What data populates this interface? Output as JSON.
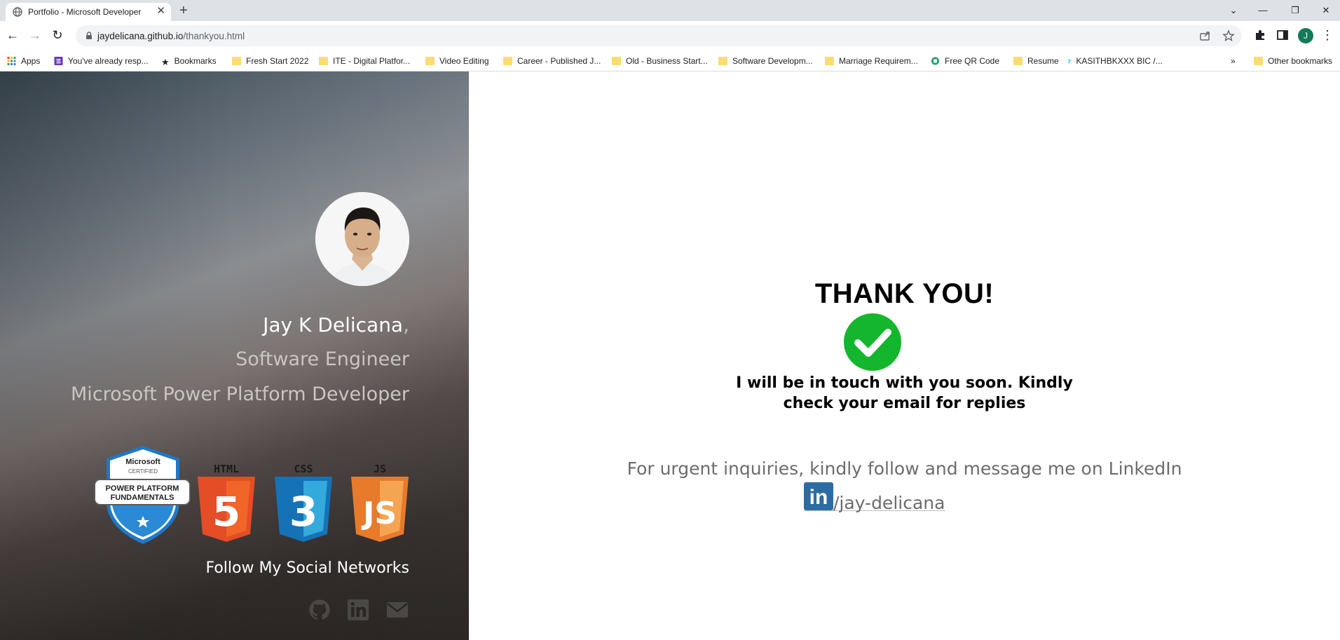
{
  "browser": {
    "tab_title": "Portfolio - Microsoft Developer",
    "url_host": "jaydelicana.github.io",
    "url_path": "/thankyou.html",
    "profile_initial": "J",
    "bookmarks": [
      {
        "label": "Apps",
        "icon": "apps-grid-icon"
      },
      {
        "label": "You've already resp...",
        "icon": "form-icon"
      },
      {
        "label": "Bookmarks",
        "icon": "star-icon"
      },
      {
        "label": "Fresh Start 2022",
        "icon": "folder-icon"
      },
      {
        "label": "ITE - Digital Platfor...",
        "icon": "folder-icon"
      },
      {
        "label": "Video Editing",
        "icon": "folder-icon"
      },
      {
        "label": "Career - Published J...",
        "icon": "folder-icon"
      },
      {
        "label": "Old - Business Start...",
        "icon": "folder-icon"
      },
      {
        "label": "Software Developm...",
        "icon": "folder-icon"
      },
      {
        "label": "Marriage Requirem...",
        "icon": "folder-icon"
      },
      {
        "label": "Free QR Code",
        "icon": "qr-site-icon"
      },
      {
        "label": "Resume",
        "icon": "folder-icon"
      },
      {
        "label": "KASITHBKXXX BIC /...",
        "icon": "wise-icon"
      }
    ],
    "more_bookmarks": "»",
    "other_bookmarks": "Other bookmarks"
  },
  "sidebar": {
    "name": "Jay K Delicana",
    "name_suffix": ",",
    "role_1": "Software Engineer",
    "role_2": "Microsoft Power Platform Developer",
    "cert_badge": {
      "brand": "Microsoft",
      "level": "CERTIFIED",
      "title_1": "POWER PLATFORM",
      "title_2": "FUNDAMENTALS"
    },
    "tech_badges": [
      {
        "label": "HTML",
        "glyph": "5",
        "color": "#e44d26"
      },
      {
        "label": "CSS",
        "glyph": "3",
        "color": "#1572b6"
      },
      {
        "label": "JS",
        "glyph": "JS",
        "color": "#f0762a"
      }
    ],
    "follow_heading": "Follow My Social Networks",
    "social_icons": [
      "github-icon",
      "linkedin-icon",
      "envelope-icon"
    ]
  },
  "main": {
    "heading": "THANK YOU!",
    "message_line_1": "I will be in touch with you soon. Kindly",
    "message_line_2": "check your email for replies",
    "urgent_text": "For urgent inquiries, kindly follow and message me on LinkedIn",
    "linkedin_icon_text": "in",
    "linkedin_handle": "/jay-delicana",
    "accent_check": "#13b62c",
    "linkedin_blue": "#2d6ca2"
  }
}
